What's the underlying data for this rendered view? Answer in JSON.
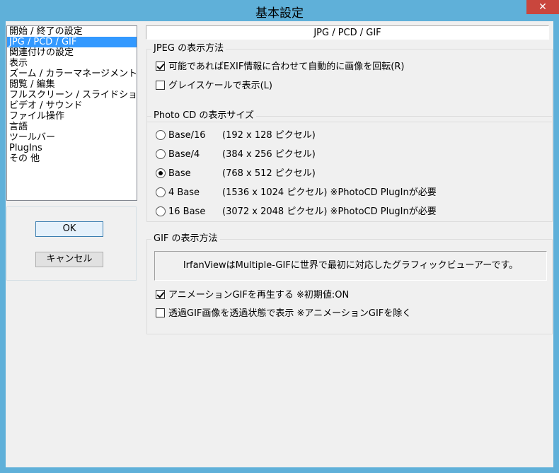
{
  "window": {
    "title": "基本設定",
    "close_label": "✕"
  },
  "categories": [
    {
      "label": "開始 / 終了の設定",
      "selected": false
    },
    {
      "label": "JPG / PCD / GIF",
      "selected": true
    },
    {
      "label": "関連付けの設定",
      "selected": false
    },
    {
      "label": "表示",
      "selected": false
    },
    {
      "label": "ズーム / カラーマネージメント",
      "selected": false
    },
    {
      "label": "閲覧 / 編集",
      "selected": false
    },
    {
      "label": "フルスクリーン / スライドショー",
      "selected": false
    },
    {
      "label": "ビデオ / サウンド",
      "selected": false
    },
    {
      "label": "ファイル操作",
      "selected": false
    },
    {
      "label": "言語",
      "selected": false
    },
    {
      "label": "ツールバー",
      "selected": false
    },
    {
      "label": "PlugIns",
      "selected": false
    },
    {
      "label": "その 他",
      "selected": false
    }
  ],
  "buttons": {
    "ok": "OK",
    "cancel": "キャンセル"
  },
  "page_header": "JPG / PCD / GIF",
  "jpeg": {
    "title": "JPEG の表示方法",
    "auto_rotate": {
      "label": "可能であればEXIF情報に合わせて自動的に画像を回転(R)",
      "checked": true
    },
    "grayscale": {
      "label": "グレイスケールで表示(L)",
      "checked": false
    }
  },
  "photocd": {
    "title": "Photo CD の表示サイズ",
    "options": [
      {
        "label": "Base/16",
        "size": "(192 x 128 ピクセル)",
        "note": "",
        "selected": false
      },
      {
        "label": "Base/4",
        "size": "(384 x 256 ピクセル)",
        "note": "",
        "selected": false
      },
      {
        "label": "Base",
        "size": "(768 x 512 ピクセル)",
        "note": "",
        "selected": true
      },
      {
        "label": "4 Base",
        "size": "(1536 x 1024 ピクセル)",
        "note": "※PhotoCD PlugInが必要",
        "selected": false
      },
      {
        "label": "16 Base",
        "size": "(3072 x 2048 ピクセル)",
        "note": "※PhotoCD PlugInが必要",
        "selected": false
      }
    ]
  },
  "gif": {
    "title": "GIF の表示方法",
    "info": "IrfanViewはMultiple-GIFに世界で最初に対応したグラフィックビューアーです。",
    "animate": {
      "label": "アニメーションGIFを再生する ※初期値:ON",
      "checked": true
    },
    "transparent": {
      "label": "透過GIF画像を透過状態で表示 ※アニメーションGIFを除く",
      "checked": false
    }
  }
}
